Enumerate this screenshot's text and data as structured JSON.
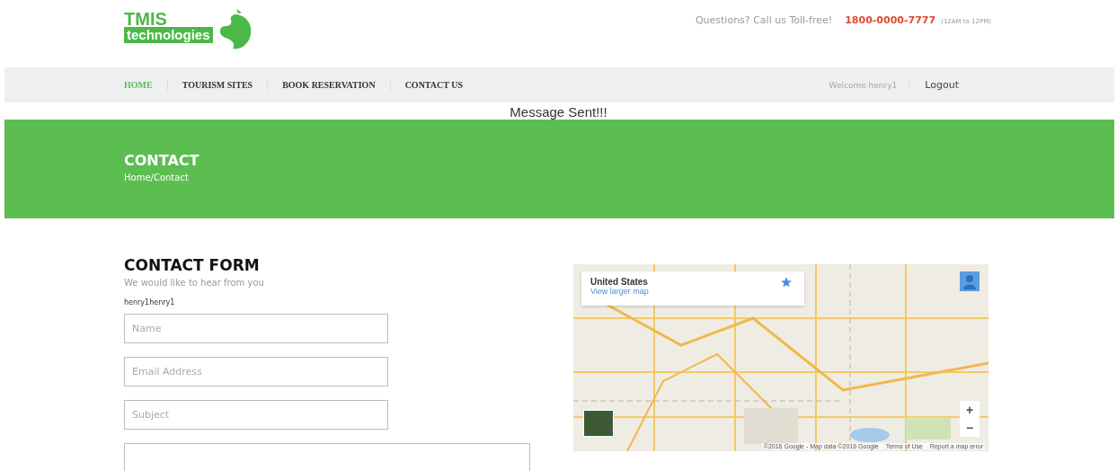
{
  "logo": {
    "line_1": "TMIS",
    "line_2": "technologies"
  },
  "contact_bar": {
    "question": "Questions? Call us Toll-free!",
    "phone": "1800-0000-7777",
    "hours": "(12AM to 12PM)"
  },
  "nav": {
    "items": [
      {
        "label": "HOME",
        "selected": true
      },
      {
        "label": "TOURISM SITES",
        "selected": false
      },
      {
        "label": "BOOK RESERVATION",
        "selected": false
      },
      {
        "label": "CONTACT US",
        "selected": false
      }
    ],
    "welcome": "Welcome henry1",
    "logout": "Logout"
  },
  "flash_message": "Message Sent!!!",
  "banner": {
    "title": "CONTACT",
    "breadcrumb": "Home/Contact"
  },
  "form": {
    "title": "CONTACT FORM",
    "subtitle": "We would like to hear from you",
    "user": "henry1henry1",
    "fields": [
      {
        "placeholder": "Name"
      },
      {
        "placeholder": "Email Address"
      },
      {
        "placeholder": "Subject"
      }
    ]
  },
  "map": {
    "place": "United States",
    "link": "View larger map",
    "zoom_in": "+",
    "zoom_out": "−",
    "attribution": "©2016 Google - Map data ©2016 Google",
    "terms": "Terms of Use",
    "report": "Report a map error"
  }
}
